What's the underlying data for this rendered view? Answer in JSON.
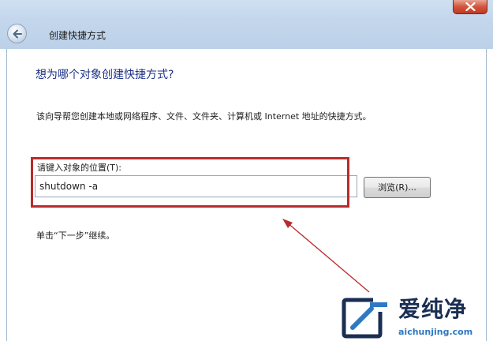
{
  "window": {
    "title": "创建快捷方式"
  },
  "wizard": {
    "heading": "想为哪个对象创建快捷方式?",
    "description": "该向导帮您创建本地或网络程序、文件、文件夹、计算机或 Internet 地址的快捷方式。",
    "location_label": "请键入对象的位置(T):",
    "location_value": "shutdown -a",
    "browse_label": "浏览(R)...",
    "hint": "单击“下一步”继续。"
  },
  "watermark": {
    "title": "爱纯净",
    "url": "aichunjing.com"
  },
  "colors": {
    "annotation": "#b92b2b",
    "heading": "#1e3287",
    "watermark_blue": "#2f78c2"
  },
  "icons": [
    "back-arrow-icon",
    "close-icon",
    "watermark-logo-icon"
  ]
}
